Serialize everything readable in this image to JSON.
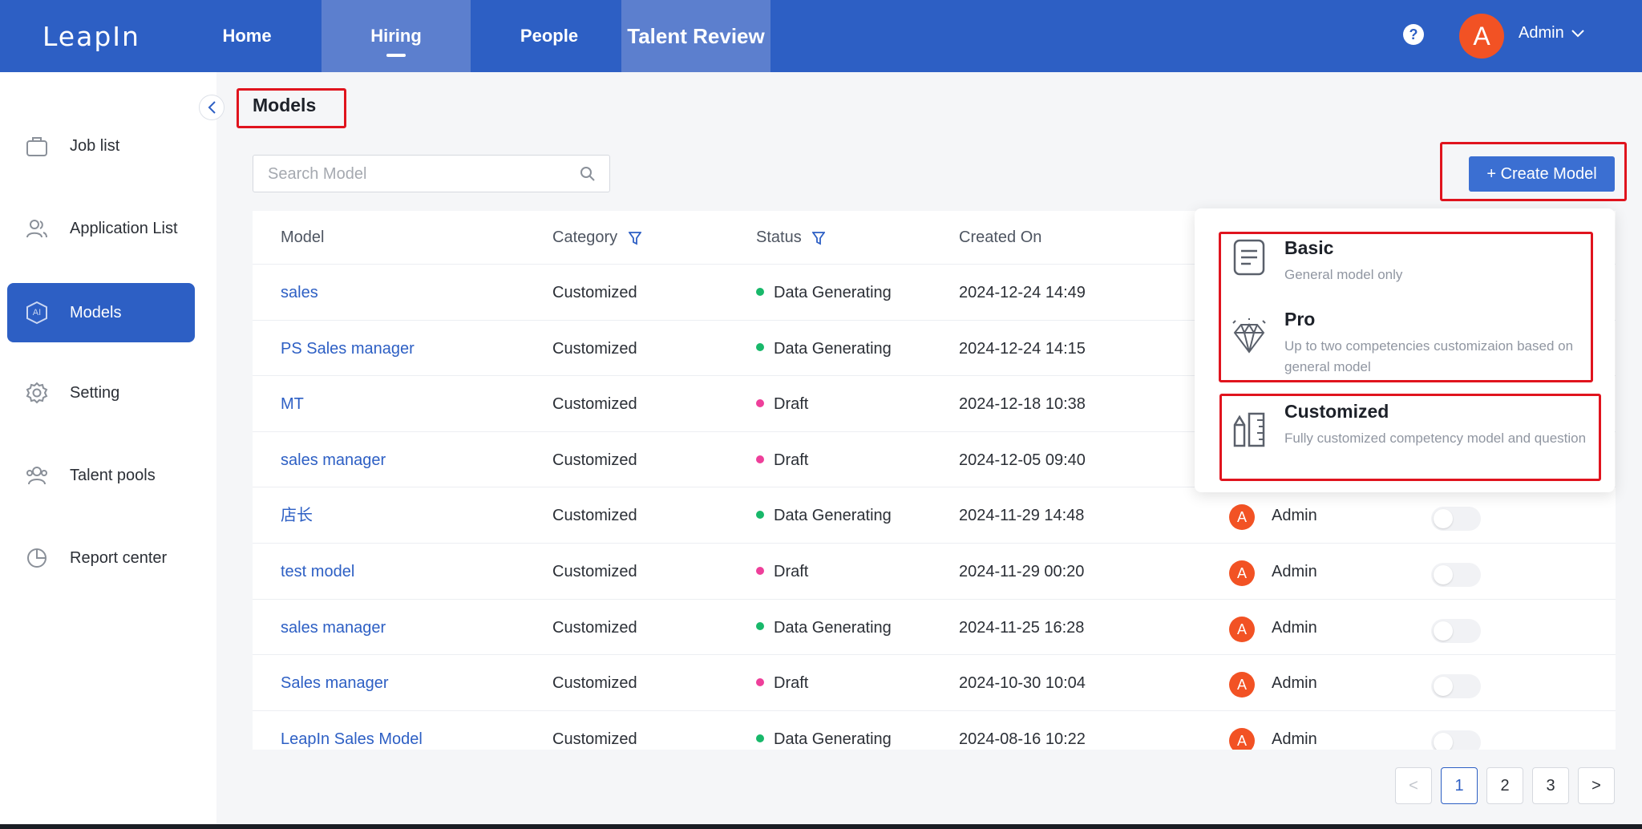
{
  "app": {
    "logo": "LeapIn"
  },
  "nav": {
    "tabs": [
      {
        "label": "Home"
      },
      {
        "label": "Hiring"
      },
      {
        "label": "People"
      },
      {
        "label": "Talent Review"
      }
    ],
    "help_icon": "?",
    "avatar_initial": "A",
    "user_name": "Admin"
  },
  "sidebar": {
    "items": [
      {
        "label": "Job list",
        "icon": "briefcase-icon"
      },
      {
        "label": "Application List",
        "icon": "users-icon"
      },
      {
        "label": "Models",
        "icon": "ai-shield-icon",
        "icon_text": "AI"
      },
      {
        "label": "Setting",
        "icon": "gear-icon"
      },
      {
        "label": "Talent pools",
        "icon": "group-icon"
      },
      {
        "label": "Report center",
        "icon": "pie-chart-icon"
      }
    ]
  },
  "page": {
    "title": "Models"
  },
  "search": {
    "placeholder": "Search Model"
  },
  "create_button": {
    "label": "+ Create Model"
  },
  "table": {
    "headers": {
      "model": "Model",
      "category": "Category",
      "status": "Status",
      "created_on": "Created On"
    },
    "rows": [
      {
        "model": "sales",
        "category": "Customized",
        "status": "Data Generating",
        "created_on": "2024-12-24 14:49",
        "creator": "",
        "initial": ""
      },
      {
        "model": "PS Sales manager",
        "category": "Customized",
        "status": "Data Generating",
        "created_on": "2024-12-24 14:15",
        "creator": "",
        "initial": ""
      },
      {
        "model": "MT",
        "category": "Customized",
        "status": "Draft",
        "created_on": "2024-12-18 10:38",
        "creator": "",
        "initial": ""
      },
      {
        "model": "sales manager",
        "category": "Customized",
        "status": "Draft",
        "created_on": "2024-12-05 09:40",
        "creator": "",
        "initial": ""
      },
      {
        "model": "店长",
        "category": "Customized",
        "status": "Data Generating",
        "created_on": "2024-11-29 14:48",
        "creator": "Admin",
        "initial": "A"
      },
      {
        "model": "test model",
        "category": "Customized",
        "status": "Draft",
        "created_on": "2024-11-29 00:20",
        "creator": "Admin",
        "initial": "A"
      },
      {
        "model": "sales manager",
        "category": "Customized",
        "status": "Data Generating",
        "created_on": "2024-11-25 16:28",
        "creator": "Admin",
        "initial": "A"
      },
      {
        "model": "Sales manager",
        "category": "Customized",
        "status": "Draft",
        "created_on": "2024-10-30 10:04",
        "creator": "Admin",
        "initial": "A"
      },
      {
        "model": "LeapIn Sales Model",
        "category": "Customized",
        "status": "Data Generating",
        "created_on": "2024-08-16 10:22",
        "creator": "Admin",
        "initial": "A"
      }
    ],
    "status_colors": {
      "Data Generating": "#18b86a",
      "Draft": "#ee3f9a"
    }
  },
  "dropdown": {
    "items": [
      {
        "title": "Basic",
        "desc": "General model only",
        "icon": "document-icon"
      },
      {
        "title": "Pro",
        "desc": "Up to two competencies customizaion based on general model",
        "icon": "diamond-icon"
      },
      {
        "title": "Customized",
        "desc": "Fully customized competency model and question",
        "icon": "ruler-pencil-icon"
      }
    ]
  },
  "pagination": {
    "prev": "<",
    "pages": [
      "1",
      "2",
      "3"
    ],
    "next": ">",
    "current": "1"
  },
  "colors": {
    "brand": "#2d5fc4",
    "avatar": "#f25224",
    "highlight_box": "#e0141e"
  }
}
